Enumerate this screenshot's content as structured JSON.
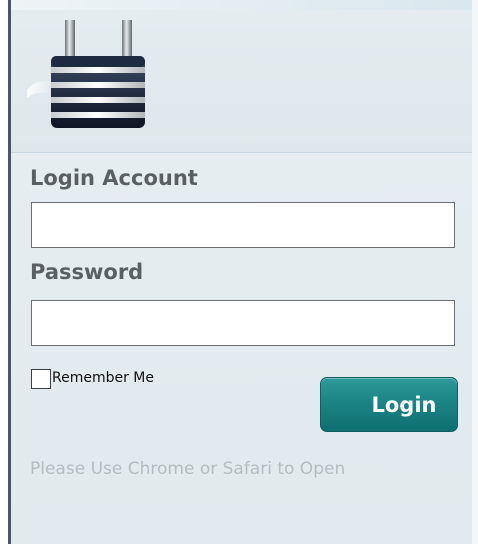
{
  "login_form": {
    "account_label": "Login Account",
    "account_value": "",
    "password_label": "Password",
    "password_value": "",
    "remember_label": "Remember Me",
    "remember_checked": false,
    "login_button_label": "Login",
    "browser_notice": "Please Use Chrome or Safari to Open"
  },
  "icons": {
    "header_icon": "lock-icon"
  },
  "colors": {
    "button": "#1b8484",
    "label_text": "#5a5f64",
    "notice_text": "#b7bcc0",
    "panel_background": "#e3eaee"
  }
}
